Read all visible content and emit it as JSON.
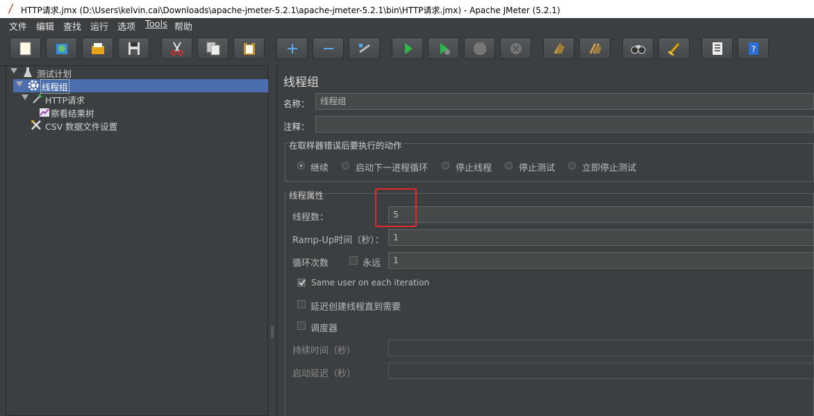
{
  "window": {
    "title": "HTTP请求.jmx (D:\\Users\\kelvin.cai\\Downloads\\apache-jmeter-5.2.1\\apache-jmeter-5.2.1\\bin\\HTTP请求.jmx) - Apache JMeter (5.2.1)"
  },
  "menu": [
    "文件",
    "编辑",
    "查找",
    "运行",
    "选项",
    "Tools",
    "帮助"
  ],
  "toolbar": [
    {
      "name": "new-icon"
    },
    {
      "name": "templates-icon"
    },
    {
      "name": "open-icon"
    },
    {
      "name": "save-icon"
    },
    {
      "name": "cut-icon"
    },
    {
      "name": "copy-icon"
    },
    {
      "name": "paste-icon"
    },
    {
      "name": "expand-icon"
    },
    {
      "name": "collapse-icon"
    },
    {
      "name": "toggle-icon"
    },
    {
      "name": "start-icon"
    },
    {
      "name": "start-no-pause-icon"
    },
    {
      "name": "stop-icon"
    },
    {
      "name": "shutdown-icon"
    },
    {
      "name": "clear-icon"
    },
    {
      "name": "clear-all-icon"
    },
    {
      "name": "search-icon"
    },
    {
      "name": "reset-search-icon"
    },
    {
      "name": "function-helper-icon"
    },
    {
      "name": "help-icon"
    }
  ],
  "tree": {
    "test_plan": "测试计划",
    "thread_group": "线程组",
    "http_request": "HTTP请求",
    "result_tree": "察看结果树",
    "csv_config": "CSV 数据文件设置"
  },
  "panel": {
    "title": "线程组",
    "name_label": "名称：",
    "name_value": "线程组",
    "comment_label": "注释：",
    "comment_value": "",
    "error_action": {
      "title": "在取样器错误后要执行的动作",
      "options": [
        "继续",
        "启动下一进程循环",
        "停止线程",
        "停止测试",
        "立即停止测试"
      ],
      "selected": "继续"
    },
    "thread_props": {
      "title": "线程属性",
      "threads_label": "线程数：",
      "threads_value": "5",
      "rampup_label": "Ramp-Up时间（秒）：",
      "rampup_value": "1",
      "loop_label": "循环次数",
      "forever_label": "永远",
      "forever_checked": false,
      "loop_value": "1",
      "same_user_label": "Same user on each iteration",
      "same_user_checked": true,
      "delay_label": "延迟创建线程直到需要",
      "delay_checked": false,
      "scheduler_label": "调度器",
      "scheduler_checked": false,
      "duration_label": "持续时间（秒）",
      "duration_value": "",
      "startup_delay_label": "启动延迟（秒）",
      "startup_delay_value": ""
    }
  }
}
